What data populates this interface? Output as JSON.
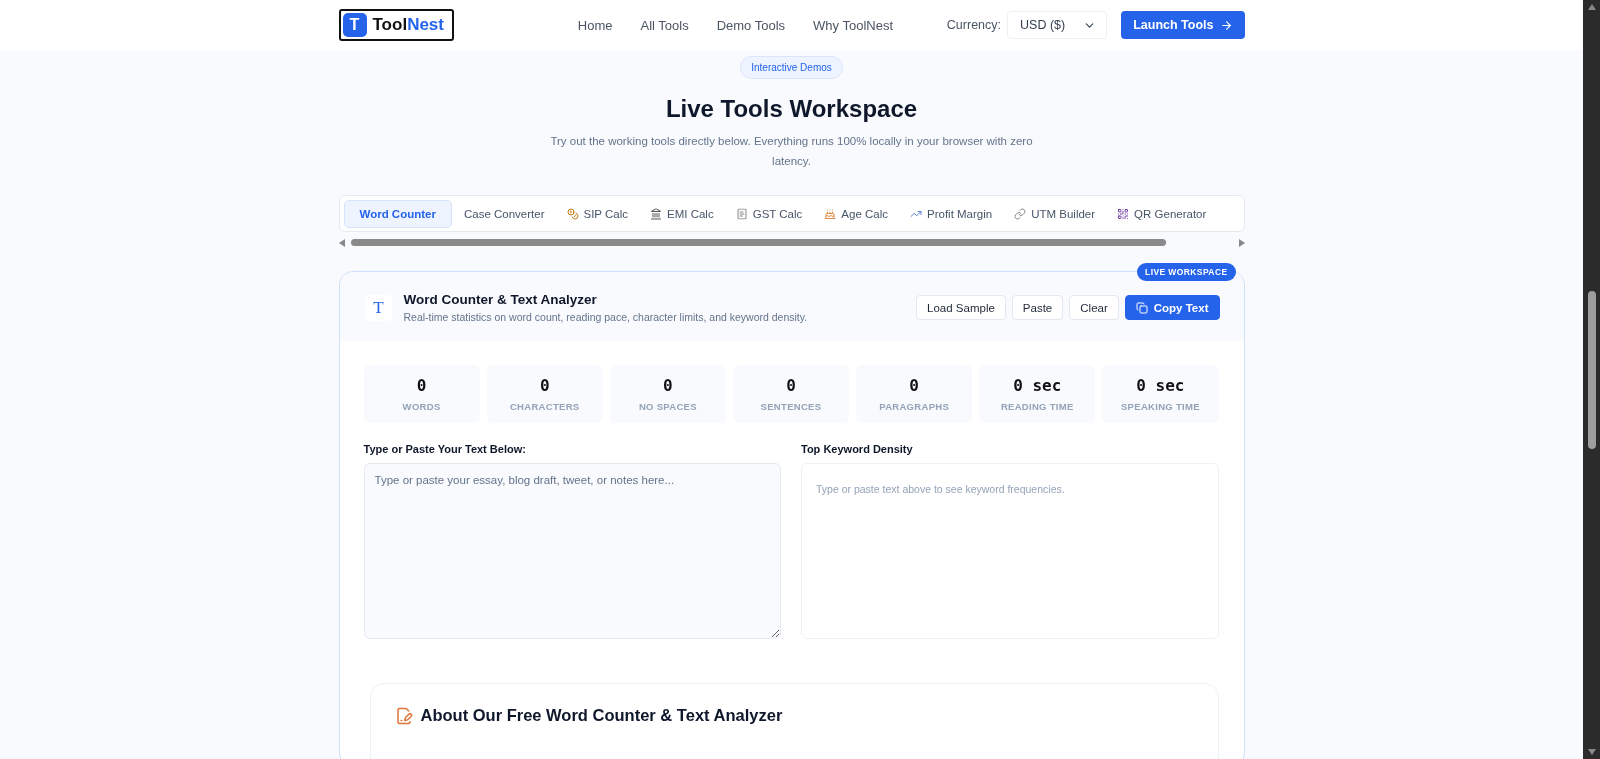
{
  "header": {
    "logo": {
      "mark": "T",
      "name_part1": "Tool",
      "name_part2": "Nest"
    },
    "nav": [
      "Home",
      "All Tools",
      "Demo Tools",
      "Why ToolNest"
    ],
    "currency": {
      "label": "Currency:",
      "value": "USD ($)"
    },
    "cta": "Launch Tools"
  },
  "hero": {
    "badge": "Interactive Demos",
    "title": "Live Tools Workspace",
    "subtitle": "Try out the working tools directly below. Everything runs 100% locally in your browser with zero latency."
  },
  "tabs": [
    {
      "label": "Word Counter",
      "selected": true
    },
    {
      "label": "Case Converter",
      "selected": false
    },
    {
      "label": "SIP Calc",
      "selected": false
    },
    {
      "label": "EMI Calc",
      "selected": false
    },
    {
      "label": "GST Calc",
      "selected": false
    },
    {
      "label": "Age Calc",
      "selected": false
    },
    {
      "label": "Profit Margin",
      "selected": false
    },
    {
      "label": "UTM Builder",
      "selected": false
    },
    {
      "label": "QR Generator",
      "selected": false
    }
  ],
  "workspace": {
    "badge": "LIVE WORKSPACE",
    "icon_letter": "T",
    "title": "Word Counter & Text Analyzer",
    "subtitle": "Real-time statistics on word count, reading pace, character limits, and keyword density.",
    "buttons": [
      {
        "label": "Load Sample",
        "kind": "secondary"
      },
      {
        "label": "Paste",
        "kind": "secondary"
      },
      {
        "label": "Clear",
        "kind": "secondary"
      },
      {
        "label": "Copy Text",
        "kind": "primary"
      }
    ],
    "stats": [
      {
        "value": "0",
        "label": "WORDS"
      },
      {
        "value": "0",
        "label": "CHARACTERS"
      },
      {
        "value": "0",
        "label": "NO SPACES"
      },
      {
        "value": "0",
        "label": "SENTENCES"
      },
      {
        "value": "0",
        "label": "PARAGRAPHS"
      },
      {
        "value": "0 sec",
        "label": "READING TIME"
      },
      {
        "value": "0 sec",
        "label": "SPEAKING TIME"
      }
    ],
    "input": {
      "label": "Type or Paste Your Text Below:",
      "placeholder": "Type or paste your essay, blog draft, tweet, or notes here..."
    },
    "density": {
      "label": "Top Keyword Density",
      "empty": "Type or paste text above to see keyword frequencies."
    },
    "about": {
      "title": "About Our Free Word Counter & Text Analyzer"
    }
  }
}
